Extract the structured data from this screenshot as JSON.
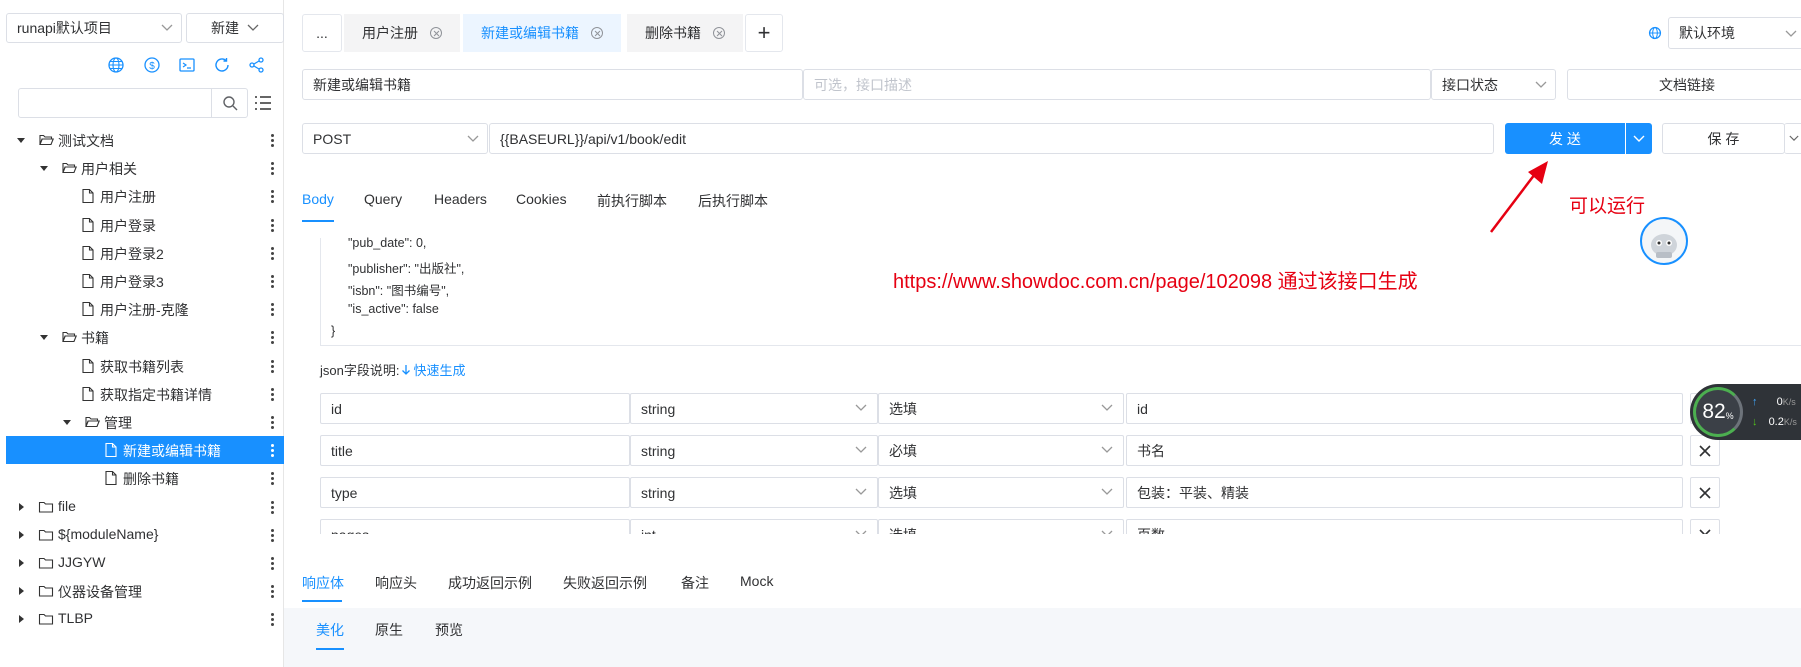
{
  "sidebar": {
    "project_select": "runapi默认项目",
    "new_button": "新建",
    "search_placeholder": "",
    "tree": [
      {
        "label": "测试文档",
        "type": "folder",
        "open": true
      },
      {
        "label": "用户相关",
        "type": "folder",
        "open": true
      },
      {
        "label": "用户注册",
        "type": "file"
      },
      {
        "label": "用户登录",
        "type": "file"
      },
      {
        "label": "用户登录2",
        "type": "file"
      },
      {
        "label": "用户登录3",
        "type": "file"
      },
      {
        "label": "用户注册-克隆",
        "type": "file"
      },
      {
        "label": "书籍",
        "type": "folder",
        "open": true
      },
      {
        "label": "获取书籍列表",
        "type": "file"
      },
      {
        "label": "获取指定书籍详情",
        "type": "file"
      },
      {
        "label": "管理",
        "type": "folder",
        "open": true
      },
      {
        "label": "新建或编辑书籍",
        "type": "file",
        "active": true
      },
      {
        "label": "删除书籍",
        "type": "file"
      },
      {
        "label": "file",
        "type": "folder",
        "open": false
      },
      {
        "label": "${moduleName}",
        "type": "folder",
        "open": false
      },
      {
        "label": "JJGYW",
        "type": "folder",
        "open": false
      },
      {
        "label": "仪器设备管理",
        "type": "folder",
        "open": false
      },
      {
        "label": "TLBP",
        "type": "folder",
        "open": false
      }
    ]
  },
  "tabs": {
    "more": "...",
    "items": [
      "用户注册",
      "新建或编辑书籍",
      "删除书籍"
    ],
    "active_index": 1,
    "add": "+"
  },
  "env_select": "默认环境",
  "request": {
    "name": "新建或编辑书籍",
    "desc_placeholder": "可选，接口描述",
    "status_select": "接口状态",
    "doc_link": "文档链接",
    "method": "POST",
    "url": "{{BASEURL}}/api/v1/book/edit",
    "send": "发 送",
    "save": "保 存"
  },
  "annotation": {
    "arrow_note": "可以运行",
    "url_note": "https://www.showdoc.com.cn/page/102098 通过该接口生成"
  },
  "req_tabs": [
    "Body",
    "Query",
    "Headers",
    "Cookies",
    "前执行脚本",
    "后执行脚本"
  ],
  "body_code": [
    "\"pub_date\": 0,",
    "\"publisher\": \"出版社\",",
    "\"isbn\": \"图书编号\",",
    "\"is_active\": false",
    "}"
  ],
  "json_desc": {
    "label": "json字段说明:",
    "quick": "快速生成"
  },
  "fields": [
    {
      "name": "id",
      "type": "string",
      "required": "选填",
      "desc": "id"
    },
    {
      "name": "title",
      "type": "string",
      "required": "必填",
      "desc": "书名"
    },
    {
      "name": "type",
      "type": "string",
      "required": "选填",
      "desc": "包装：平装、精装"
    },
    {
      "name": "pages",
      "type": "int",
      "required": "选填",
      "desc": "页数"
    }
  ],
  "resp_tabs": [
    "响应体",
    "响应头",
    "成功返回示例",
    "失败返回示例",
    "备注",
    "Mock"
  ],
  "resp_subtabs": [
    "美化",
    "原生",
    "预览"
  ],
  "net_widget": {
    "percent": "82",
    "unit": "%",
    "up": "0",
    "down": "0.2",
    "rate_unit": "K/s"
  },
  "colors": {
    "accent": "#1890ff",
    "annotation": "#e60012",
    "active_tab_bg": "#ecf5ff"
  }
}
